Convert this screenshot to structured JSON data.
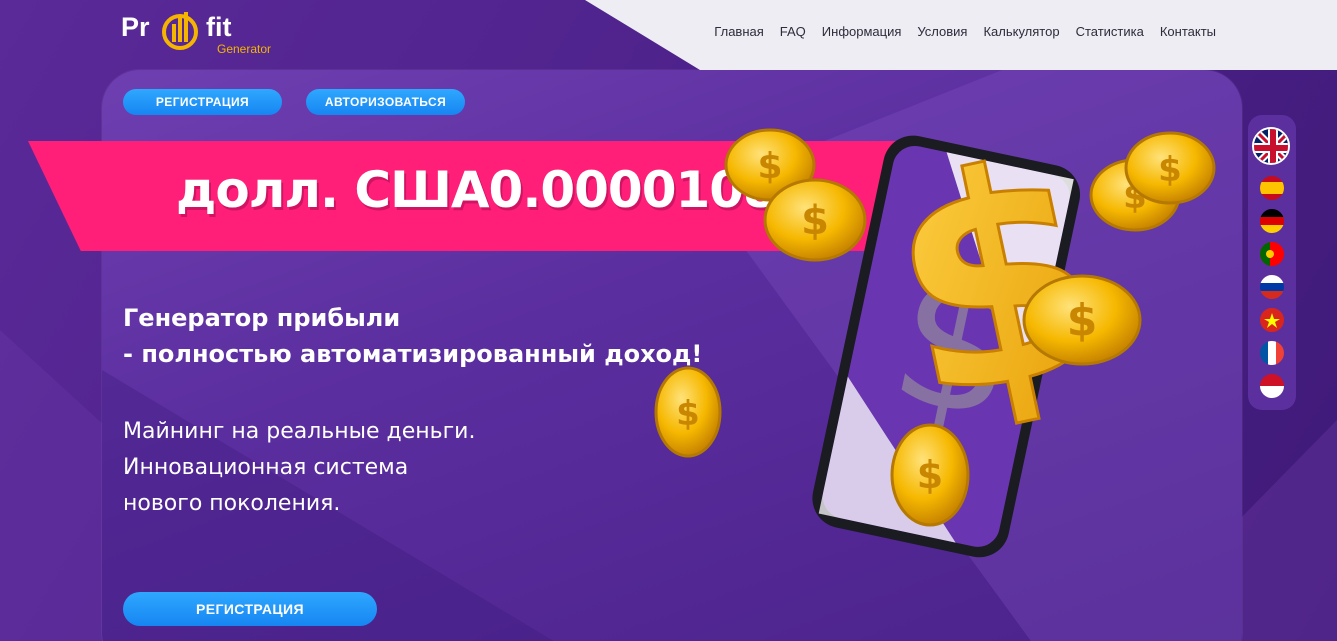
{
  "logo": {
    "part1": "Pr",
    "part2": "fit",
    "subtitle": "Generator"
  },
  "nav": [
    "Главная",
    "FAQ",
    "Информация",
    "Условия",
    "Калькулятор",
    "Статистика",
    "Контакты"
  ],
  "buttons": {
    "register_top": "РЕГИСТРАЦИЯ",
    "authorize_top": "АВТОРИЗОВАТЬСЯ",
    "register_bottom": "РЕГИСТРАЦИЯ"
  },
  "ribbon": {
    "price": "долл. США0.00001080"
  },
  "headline": {
    "line1": "Генератор прибыли",
    "line2": "- полностью автоматизированный доход!"
  },
  "subtext": {
    "line1": "Майнинг на реальные деньги.",
    "line2": "Инновационная система",
    "line3": "нового поколения."
  },
  "languages": [
    "uk-flag-icon",
    "es-flag-icon",
    "de-flag-icon",
    "pt-flag-icon",
    "ru-flag-icon",
    "vn-flag-icon",
    "fr-flag-icon",
    "id-flag-icon"
  ],
  "colors": {
    "accent_pink": "#ff1f78",
    "button_blue": "#1e93f7",
    "purple": "#5b2e9f",
    "gold": "#f4b400"
  }
}
